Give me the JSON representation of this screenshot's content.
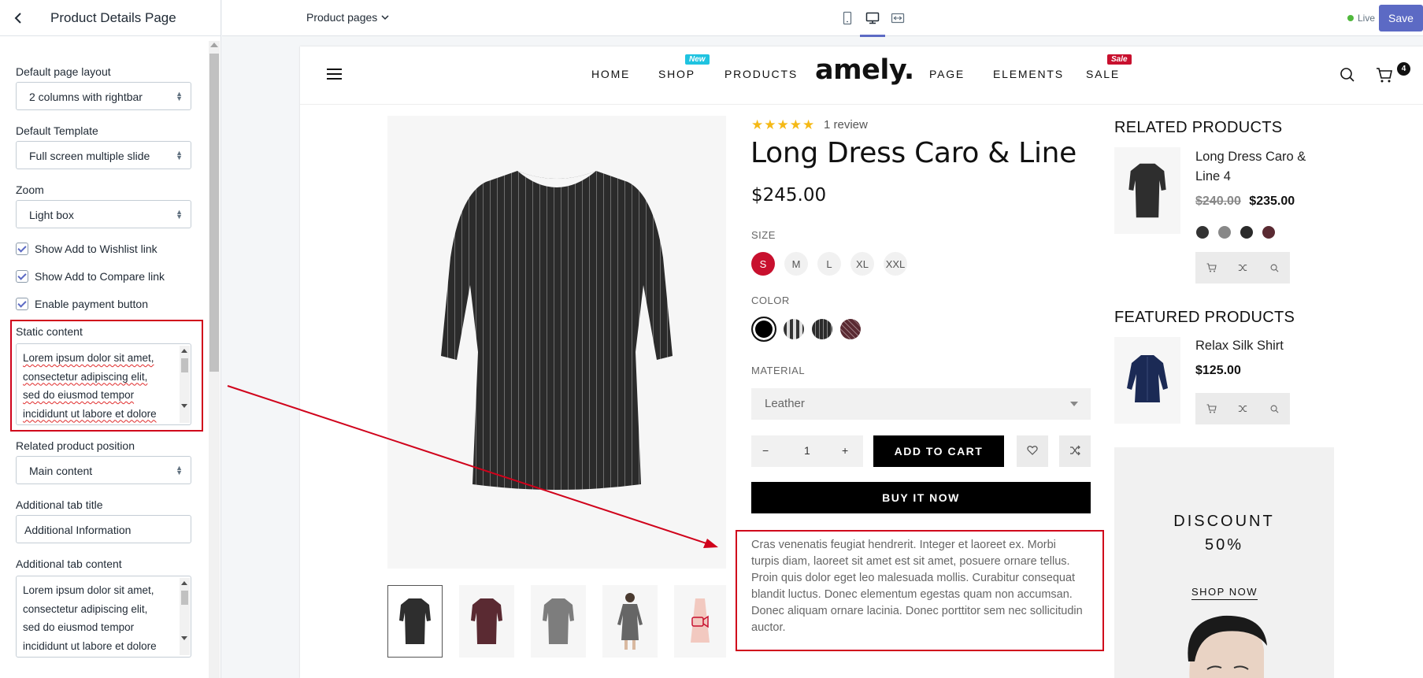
{
  "editor": {
    "title": "Product Details Page",
    "page_selector": "Product pages",
    "live_label": "Live",
    "save_label": "Save"
  },
  "settings": {
    "layout_label": "Default page layout",
    "layout_value": "2 columns with rightbar",
    "template_label": "Default Template",
    "template_value": "Full screen multiple slide",
    "zoom_label": "Zoom",
    "zoom_value": "Light box",
    "checkboxes": [
      {
        "label": "Show Add to Wishlist link",
        "checked": true
      },
      {
        "label": "Show Add to Compare link",
        "checked": true
      },
      {
        "label": "Enable payment button",
        "checked": true
      }
    ],
    "static_label": "Static content",
    "static_lines": [
      "Lorem ipsum dolor sit amet,",
      "consectetur adipiscing elit,",
      "sed do eiusmod tempor",
      "incididunt ut labore et dolore"
    ],
    "related_pos_label": "Related product position",
    "related_pos_value": "Main content",
    "tab_title_label": "Additional tab title",
    "tab_title_value": "Additional Information",
    "tab_content_label": "Additional tab content",
    "tab_content_lines": [
      "Lorem ipsum dolor sit amet,",
      "consectetur adipiscing elit,",
      "sed do eiusmod tempor",
      "incididunt ut labore et dolore"
    ]
  },
  "site": {
    "logo": "amely.",
    "nav": [
      "HOME",
      "SHOP",
      "PRODUCTS",
      "PAGE",
      "ELEMENTS",
      "SALE"
    ],
    "badge_new": "New",
    "badge_sale": "Sale",
    "cart_count": "4"
  },
  "product": {
    "stars": "★★★★★",
    "reviews": "1 review",
    "title": "Long Dress Caro & Line",
    "price": "$245.00",
    "size_label": "SIZE",
    "sizes": [
      "S",
      "M",
      "L",
      "XL",
      "XXL"
    ],
    "color_label": "COLOR",
    "material_label": "MATERIAL",
    "material_value": "Leather",
    "qty": "1",
    "minus": "−",
    "plus": "+",
    "add_to_cart": "ADD TO CART",
    "buy_now": "BUY IT NOW",
    "static_content": "Cras venenatis feugiat hendrerit. Integer et laoreet ex. Morbi turpis diam, laoreet sit amet est sit amet, posuere ornare tellus. Proin quis dolor eget leo malesuada mollis. Curabitur consequat blandit luctus. Donec elementum egestas quam non accumsan. Donec aliquam ornare lacinia. Donec porttitor sem nec sollicitudin auctor."
  },
  "sidebar": {
    "related_title": "RELATED PRODUCTS",
    "related": {
      "name": "Long Dress Caro & Line 4",
      "old_price": "$240.00",
      "price": "$235.00"
    },
    "featured_title": "FEATURED PRODUCTS",
    "featured": {
      "name": "Relax Silk Shirt",
      "price": "$125.00"
    },
    "discount_line1": "DISCOUNT",
    "discount_line2": "50%",
    "shop_now": "SHOP NOW"
  },
  "colors": {
    "accent": "#5c6ac4",
    "sale_red": "#c8102e",
    "new_cyan": "#1fc3e0",
    "annotation_red": "#d0021b"
  }
}
